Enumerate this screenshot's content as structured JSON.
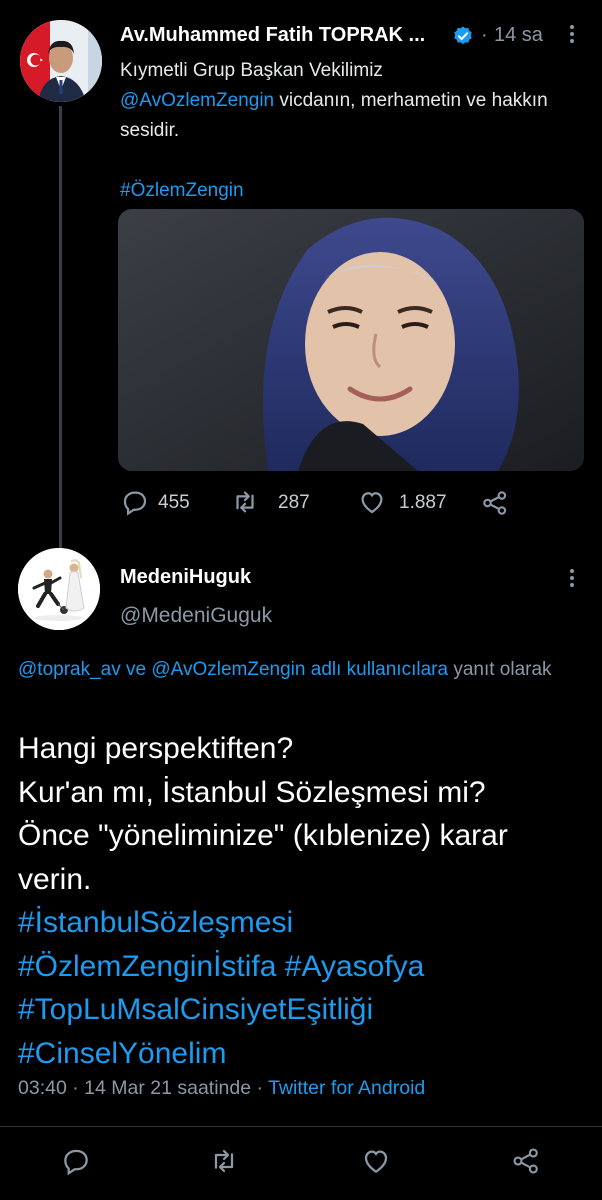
{
  "tweet1": {
    "author_name": "Av.Muhammed Fatih TOPRAK ...",
    "separator": "·",
    "time": "14 sa",
    "text_line1": "Kıymetli Grup Başkan Vekilimiz",
    "mention": "@AvOzlemZengin",
    "text_rest": " vicdanın, merhametin ve hakkın sesidir.",
    "hashtag": "#ÖzlemZengin",
    "replies": "455",
    "retweets": "287",
    "likes": "1.887",
    "icons": [
      "verified-badge-icon",
      "more-icon",
      "reply-icon",
      "retweet-icon",
      "like-icon",
      "share-icon"
    ]
  },
  "tweet2": {
    "author_name": "MedeniHuguk",
    "handle": "@MedeniGuguk",
    "reply_mention1": "@toprak_av",
    "reply_and": " ve ",
    "reply_mention2": "@AvOzlemZengin",
    "reply_suffix_link": " adlı kullanıcılara",
    "reply_suffix": " yanıt olarak",
    "line1": "Hangi perspektiften?",
    "line2": "Kur'an mı, İstanbul Sözleşmesi mi?",
    "line3": "Önce \"yöneliminize\" (kıblenize) karar verin.",
    "hashtag1": "#İstanbulSözleşmesi",
    "hashtag2": "#ÖzlemZenginİstifa",
    "hashtag3": "#Ayasofya",
    "hashtag4": "#TopLuMsalCinsiyetEşitliği",
    "hashtag5": "#CinselYönelim",
    "time": "03:40",
    "dot": " · ",
    "date": "14 Mar 21 saatinde",
    "dot2": " · ",
    "source": "Twitter for Android"
  },
  "colors": {
    "background": "#000000",
    "link": "#1d9bf0",
    "muted": "#8b98a5",
    "text": "#e7e9ea"
  }
}
